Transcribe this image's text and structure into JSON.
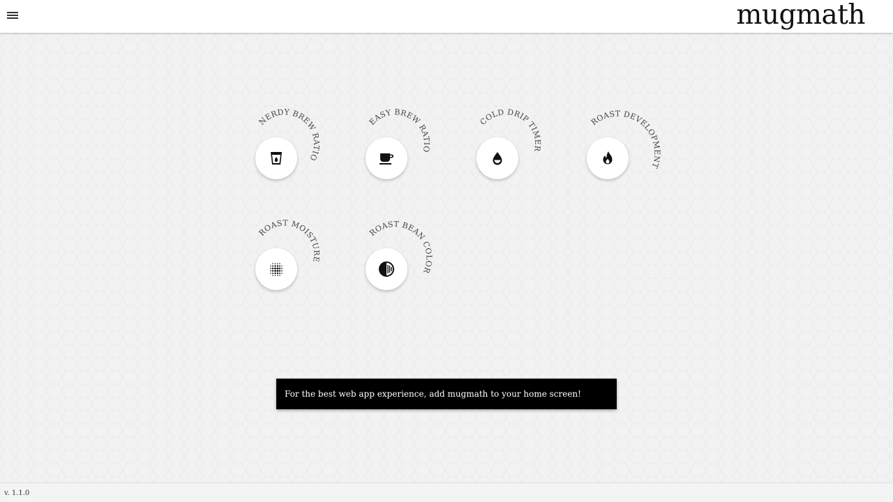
{
  "header": {
    "brand": "mugmath",
    "menu_icon": "hamburger-menu-icon"
  },
  "tools": [
    {
      "label": "NERDY BREW RATIO",
      "icon": "glass-drop-icon"
    },
    {
      "label": "EASY BREW RATIO",
      "icon": "coffee-cup-icon"
    },
    {
      "label": "COLD DRIP TIMER",
      "icon": "water-drop-icon"
    },
    {
      "label": "ROAST DEVELOPMENT",
      "icon": "flame-icon"
    },
    {
      "label": "ROAST MOISTURE",
      "icon": "dot-grid-icon"
    },
    {
      "label": "ROAST BEAN COLOR",
      "icon": "half-circle-icon"
    }
  ],
  "toast": {
    "message": "For the best web app experience, add mugmath to your home screen!"
  },
  "footer": {
    "version": "v. 1.1.0"
  }
}
